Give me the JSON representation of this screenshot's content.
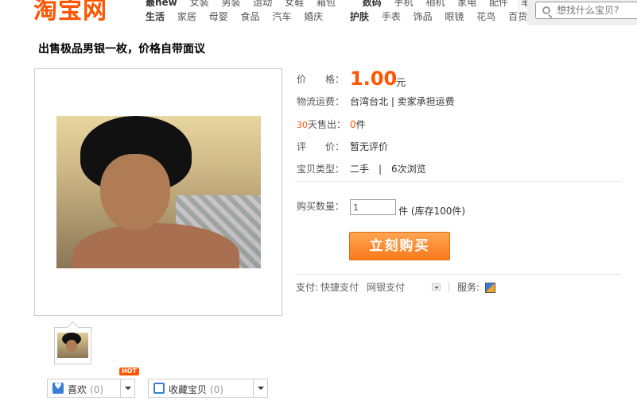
{
  "header": {
    "logo": "淘宝网",
    "nav_row1": {
      "head": "最new",
      "items": [
        "女装",
        "男装",
        "运动",
        "女鞋",
        "箱包"
      ],
      "head2": "数码",
      "items2": [
        "手机",
        "相机",
        "家电",
        "配件",
        "笔记本"
      ]
    },
    "nav_row2": {
      "head": "生活",
      "items": [
        "家居",
        "母婴",
        "食品",
        "汽车",
        "婚庆"
      ],
      "head2": "护肤",
      "items2": [
        "手表",
        "饰品",
        "眼镜",
        "花鸟",
        "百货"
      ]
    },
    "search": {
      "placeholder": "想找什么宝贝?"
    }
  },
  "item": {
    "title": "出售极品男银一枚，价格自带面议",
    "price_label": "价　　格：",
    "price": "1.00",
    "price_unit": "元",
    "shipping_label": "物流运费：",
    "shipping_value": "台湾台北 | 卖家承担运费",
    "sold_prefix": "30",
    "sold_label": "天售出：",
    "sold_count": "0",
    "sold_unit": "件",
    "review_label": "评　　价：",
    "review_value": "暂无评价",
    "type_label": "宝贝类型：",
    "type_value": "二手　|　6次浏览",
    "qty_label": "购买数量：",
    "qty_value": "1",
    "qty_unit": "件 (库存100件)",
    "buy_label": "立刻购买"
  },
  "payment": {
    "label": "支付:",
    "methods": [
      "快捷支付",
      "网银支付"
    ],
    "service_label": "服务:"
  },
  "actions": {
    "like_label": "喜欢",
    "like_count": "(0)",
    "fav_label": "收藏宝贝",
    "fav_count": "(0)",
    "hot_badge": "HOT"
  },
  "icons": [
    "search-icon",
    "heart-icon",
    "favorite-icon",
    "chevron-down-icon",
    "service-icon"
  ],
  "colors": {
    "accent": "#ff5500",
    "buy_button": "#f97a1c",
    "link_blue": "#3a7fd5"
  }
}
